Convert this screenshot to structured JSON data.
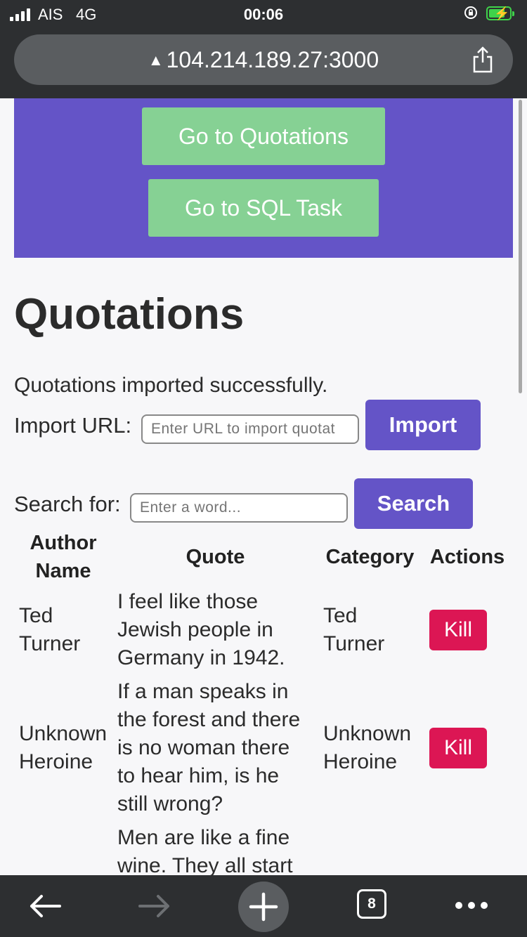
{
  "status_bar": {
    "carrier": "AIS",
    "network": "4G",
    "time": "00:06"
  },
  "browser": {
    "url": "104.214.189.27:3000",
    "open_tabs": "8"
  },
  "nav": {
    "quotations_label": "Go to Quotations",
    "sql_task_label": "Go to SQL Task"
  },
  "page": {
    "title": "Quotations",
    "success_message": "Quotations imported successfully.",
    "import": {
      "label": "Import URL:",
      "placeholder": "Enter URL to import quotat",
      "button_label": "Import"
    },
    "search": {
      "label": "Search for:",
      "placeholder": "Enter a word...",
      "button_label": "Search"
    }
  },
  "table": {
    "headers": {
      "author_line1": "Author",
      "author_line2": "Name",
      "quote": "Quote",
      "category": "Category",
      "actions": "Actions"
    },
    "rows": [
      {
        "author": [
          "Ted",
          "Turner"
        ],
        "quote": [
          "I feel like those",
          "Jewish people in",
          "Germany in 1942."
        ],
        "category": [
          "Ted",
          "Turner"
        ],
        "action_label": "Kill"
      },
      {
        "author": [
          "Unknown",
          "Heroine"
        ],
        "quote": [
          "If a man speaks in",
          "the forest and there",
          "is no woman there",
          "to hear him, is he",
          "still wrong?"
        ],
        "category": [
          "Unknown",
          "Heroine"
        ],
        "action_label": "Kill"
      },
      {
        "author": [
          "",
          ""
        ],
        "quote": [
          "Men are like a fine",
          "wine. They all start"
        ],
        "category": [
          "",
          ""
        ],
        "action_label": ""
      }
    ]
  },
  "icons": {
    "warning": "warning-icon",
    "share": "share-icon",
    "back": "back-arrow-icon",
    "forward": "forward-arrow-icon",
    "new_tab": "plus-icon",
    "tabs": "tabs-icon",
    "menu": "more-icon"
  },
  "colors": {
    "nav_panel": "#6454c7",
    "nav_button": "#86d194",
    "primary_button": "#6454c7",
    "kill_button": "#dc1654",
    "chrome": "#2d2f31"
  }
}
